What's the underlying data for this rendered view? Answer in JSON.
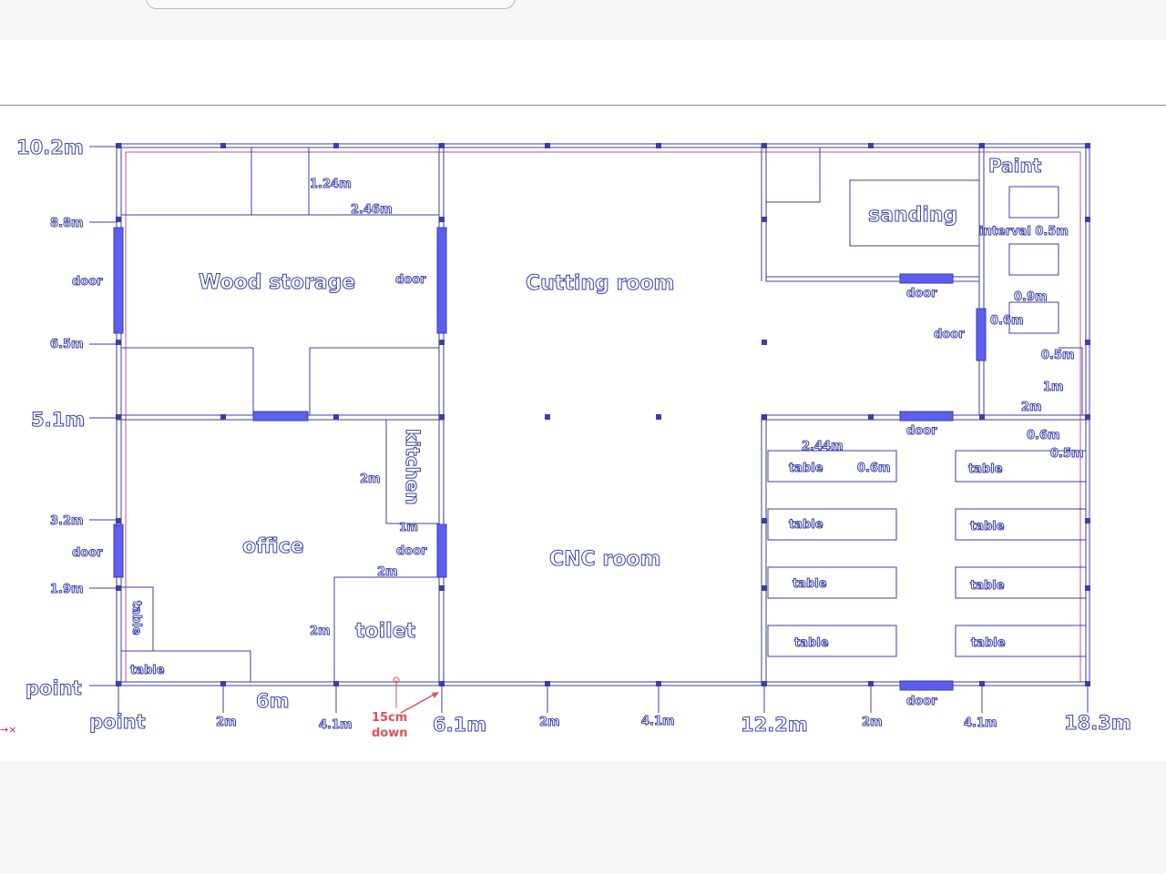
{
  "colors": {
    "wall": "#3c3f9e",
    "door": "#5a5ff0",
    "inner_boundary": "#c0509a",
    "annotation": "#e0505a"
  },
  "rooms": {
    "wood_storage": "Wood storage",
    "cutting_room": "Cutting room",
    "cnc_room": "CNC room",
    "office": "office",
    "toilet": "toilet",
    "kitchen": "kitchen",
    "sanding": "sanding",
    "paint": "Paint"
  },
  "doors": {
    "label": "door"
  },
  "tables": {
    "label": "table"
  },
  "axis": {
    "left": [
      "10.2m",
      "8.8m",
      "6.5m",
      "5.1m",
      "3.2m",
      "1.9m",
      "point"
    ],
    "bottom": [
      "point",
      "2m",
      "6m",
      "4.1m",
      "6.1m",
      "2m",
      "4.1m",
      "12.2m",
      "2m",
      "4.1m",
      "18.3m"
    ]
  },
  "dimensions": {
    "d_1_24": "1.24m",
    "d_2_46": "2.46m",
    "d_2m": "2m",
    "d_1m": "1m",
    "d_2_44": "2.44m",
    "d_0_6": "0.6m",
    "d_0_9": "0.9m",
    "d_0_5": "0.5m",
    "interval": "interval 0.5m"
  },
  "annotation": {
    "line1": "15cm",
    "line2": "down"
  },
  "marker": "→×"
}
